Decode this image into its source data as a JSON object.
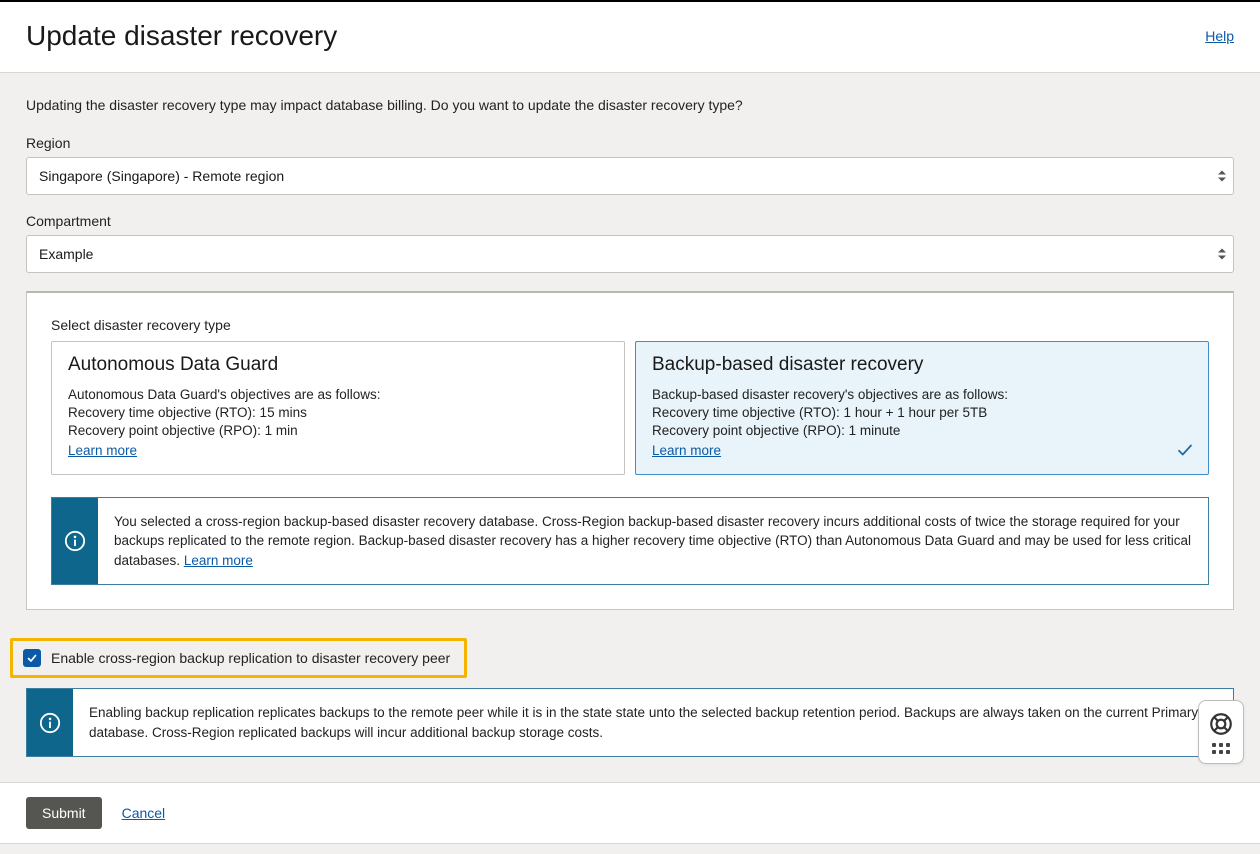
{
  "header": {
    "title": "Update disaster recovery",
    "help": "Help"
  },
  "intro": "Updating the disaster recovery type may impact database billing. Do you want to update the disaster recovery type?",
  "fields": {
    "region_label": "Region",
    "region_value": "Singapore (Singapore) - Remote region",
    "compartment_label": "Compartment",
    "compartment_value": "Example"
  },
  "dr": {
    "heading": "Select disaster recovery type",
    "cards": [
      {
        "title": "Autonomous Data Guard",
        "line1": "Autonomous Data Guard's objectives are as follows:",
        "line2": "Recovery time objective (RTO): 15 mins",
        "line3": "Recovery point objective (RPO): 1 min",
        "learn": "Learn more",
        "selected": false
      },
      {
        "title": "Backup-based disaster recovery",
        "line1": "Backup-based disaster recovery's objectives are as follows:",
        "line2": "Recovery time objective (RTO): 1 hour + 1 hour per 5TB",
        "line3": "Recovery point objective (RPO): 1 minute",
        "learn": "Learn more",
        "selected": true
      }
    ],
    "info1_text": "You selected a cross-region backup-based disaster recovery database. Cross-Region backup-based disaster recovery incurs additional costs of twice the storage required for your backups replicated to the remote region. Backup-based disaster recovery has a higher recovery time objective (RTO) than Autonomous Data Guard and may be used for less critical databases. ",
    "info1_learn": "Learn more"
  },
  "checkbox": {
    "checked": true,
    "label": "Enable cross-region backup replication to disaster recovery peer"
  },
  "info2_text": "Enabling backup replication replicates backups to the remote peer while it is in the state state unto the selected backup retention period. Backups are always taken on the current Primary database. Cross-Region replicated backups will incur additional backup storage costs.",
  "footer": {
    "submit": "Submit",
    "cancel": "Cancel"
  }
}
